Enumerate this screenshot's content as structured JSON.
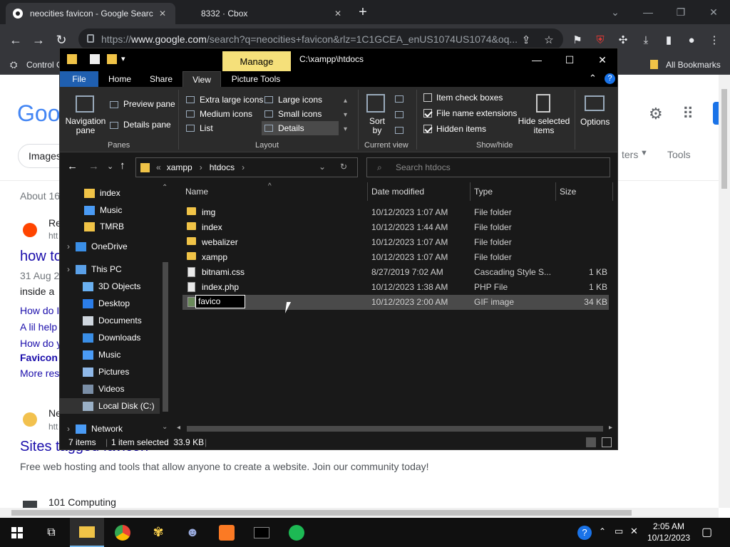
{
  "browser": {
    "tabs": [
      {
        "title": "neocities favicon - Google Searc",
        "active": true
      },
      {
        "title": "8332 · Cbox",
        "active": false
      }
    ],
    "url_prefix": "https://",
    "url_host": "www.google.com",
    "url_rest": "/search?q=neocities+favicon&rlz=1C1GCEA_enUS1074US1074&oq...",
    "bookmarks": {
      "left_label": "Control C",
      "right_label": "All Bookmarks"
    }
  },
  "google": {
    "logo": "Goo",
    "tab_images": "Images",
    "filters": "ters",
    "tools": "Tools",
    "about": "About 16",
    "result1_site": "Re",
    "result1_url": "htt",
    "result1_title": "how to",
    "result1_date": "31 Aug 2",
    "result1_snippet": "inside a",
    "links": [
      "How do I",
      "A lil help",
      "How do y"
    ],
    "favicon_link": "Favicon",
    "more": "More res",
    "result2_site": "Ne",
    "result2_url": "htt",
    "result2_title": "Sites tagged favicon",
    "result2_snippet": "Free web hosting and tools that allow anyone to create a website. Join our community today!",
    "result3_site": "101 Computing"
  },
  "explorer": {
    "manage": "Manage",
    "path_title": "C:\\xampp\\htdocs",
    "ribbon_tabs": [
      "File",
      "Home",
      "Share",
      "View",
      "Picture Tools"
    ],
    "panes": {
      "navigation_pane": "Navigation pane",
      "preview_pane": "Preview pane",
      "details_pane": "Details pane",
      "group": "Panes"
    },
    "layout": {
      "items": [
        "Extra large icons",
        "Large icons",
        "Medium icons",
        "Small icons",
        "List",
        "Details"
      ],
      "group": "Layout"
    },
    "current_view": {
      "sort_by": "Sort by",
      "group": "Current view"
    },
    "show_hide": {
      "item_check_boxes": "Item check boxes",
      "file_name_extensions": "File name extensions",
      "hidden_items": "Hidden items",
      "hide_selected": "Hide selected items",
      "group": "Show/hide"
    },
    "options": "Options",
    "address": {
      "root": "xampp",
      "folder": "htdocs"
    },
    "search_placeholder": "Search htdocs",
    "nav_items": [
      {
        "label": "index",
        "icon": "folder-icon"
      },
      {
        "label": "Music",
        "icon": "music-icon"
      },
      {
        "label": "TMRB",
        "icon": "folder-icon"
      },
      {
        "label": "OneDrive",
        "icon": "onedrive-icon"
      },
      {
        "label": "This PC",
        "icon": "pc-icon"
      },
      {
        "label": "3D Objects",
        "icon": "3d-objects-icon"
      },
      {
        "label": "Desktop",
        "icon": "desktop-icon"
      },
      {
        "label": "Documents",
        "icon": "documents-icon"
      },
      {
        "label": "Downloads",
        "icon": "downloads-icon"
      },
      {
        "label": "Music",
        "icon": "music-icon"
      },
      {
        "label": "Pictures",
        "icon": "pictures-icon"
      },
      {
        "label": "Videos",
        "icon": "videos-icon"
      },
      {
        "label": "Local Disk (C:)",
        "icon": "disk-icon"
      },
      {
        "label": "Network",
        "icon": "network-icon"
      }
    ],
    "columns": [
      "Name",
      "Date modified",
      "Type",
      "Size"
    ],
    "files": [
      {
        "name": "img",
        "date": "10/12/2023 1:07 AM",
        "type": "File folder",
        "size": "",
        "kind": "folder"
      },
      {
        "name": "index",
        "date": "10/12/2023 1:44 AM",
        "type": "File folder",
        "size": "",
        "kind": "folder"
      },
      {
        "name": "webalizer",
        "date": "10/12/2023 1:07 AM",
        "type": "File folder",
        "size": "",
        "kind": "folder"
      },
      {
        "name": "xampp",
        "date": "10/12/2023 1:07 AM",
        "type": "File folder",
        "size": "",
        "kind": "folder"
      },
      {
        "name": "bitnami.css",
        "date": "8/27/2019 7:02 AM",
        "type": "Cascading Style S...",
        "size": "1 KB",
        "kind": "file"
      },
      {
        "name": "index.php",
        "date": "10/12/2023 1:38 AM",
        "type": "PHP File",
        "size": "1 KB",
        "kind": "file"
      },
      {
        "name": "favico",
        "date": "10/12/2023 2:00 AM",
        "type": "GIF image",
        "size": "34 KB",
        "kind": "image"
      }
    ],
    "status": {
      "count": "7 items",
      "selection": "1 item selected  33.9 KB"
    }
  },
  "taskbar": {
    "time": "2:05 AM",
    "date": "10/12/2023"
  }
}
